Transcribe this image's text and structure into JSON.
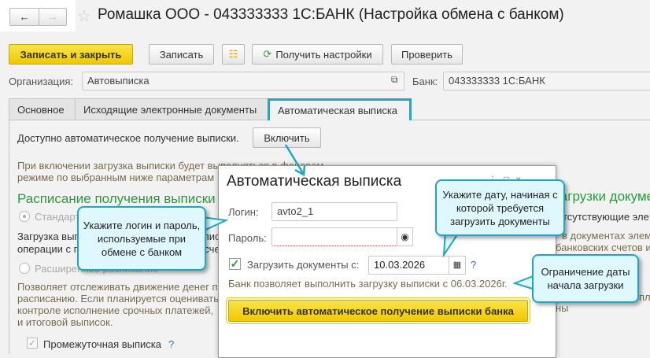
{
  "window": {
    "title": "Ромашка ООО - 043333333 1С:БАНК (Настройка обмена с банком)"
  },
  "toolbar": {
    "save_close": "Записать и закрыть",
    "save": "Записать",
    "get_settings": "Получить настройки",
    "check": "Проверить"
  },
  "form": {
    "org_label": "Организация:",
    "org_value": "Автовыписка",
    "bank_label": "Банк:",
    "bank_value": "043333333 1С:БАНК"
  },
  "tabs": [
    {
      "label": "Основное"
    },
    {
      "label": "Исходящие электронные документы"
    },
    {
      "label": "Автоматическая выписка"
    }
  ],
  "main": {
    "available_text": "Доступно автоматическое получение выписки.",
    "enable_button": "Включить",
    "info_line1": "При включении загрузка выписки будет выполняться в фоновом",
    "info_line2": "режиме по выбранным ниже параметрам",
    "schedule_heading": "Расписание получения выписки",
    "standard_radio": "Стандартное",
    "standard_desc1": "Загрузка выписки по стандартному расписанию",
    "standard_desc2": "операции с по выбранным банковским счетам",
    "extended_radio": "Расширенное расписание",
    "extended_desc": [
      "Позволяет отслеживать движение денег по",
      "расписанию. Если планируется оценивать",
      "контроле исполнение срочных платежей,",
      "и итоговой выписок."
    ],
    "intermediate_checkbox": "Промежуточная выписка",
    "help": "?",
    "right_heading": "загрузки докумен",
    "right_line1": "отсутствующие эле",
    "right_line2": "в документах элем",
    "right_line3": "банковских счетов и",
    "right_line4": "пл",
    "right_line5": "ны"
  },
  "dialog": {
    "title": "Автоматическая выписка",
    "login_label": "Логин:",
    "login_value": "avto2_1",
    "password_label": "Пароль:",
    "password_value": "",
    "load_checkbox": "Загрузить документы с:",
    "load_checked": true,
    "date_value": "10.03.2026",
    "help": "?",
    "bank_note": "Банк позволяет выполнить загрузку выписки с 06.03.2026г.",
    "enable_button": "Включить автоматическое получение выписки банка"
  },
  "callouts": {
    "login": "Укажите логин и пароль, используемые при обмене с банком",
    "date": "Укажите дату, начиная с которой требуется загрузить документы",
    "limit": "Ограничение даты начала загрузки"
  },
  "colors": {
    "accent": "#1ea6c8",
    "yellow": "#f0c800",
    "green_heading": "#2a9a3c"
  }
}
